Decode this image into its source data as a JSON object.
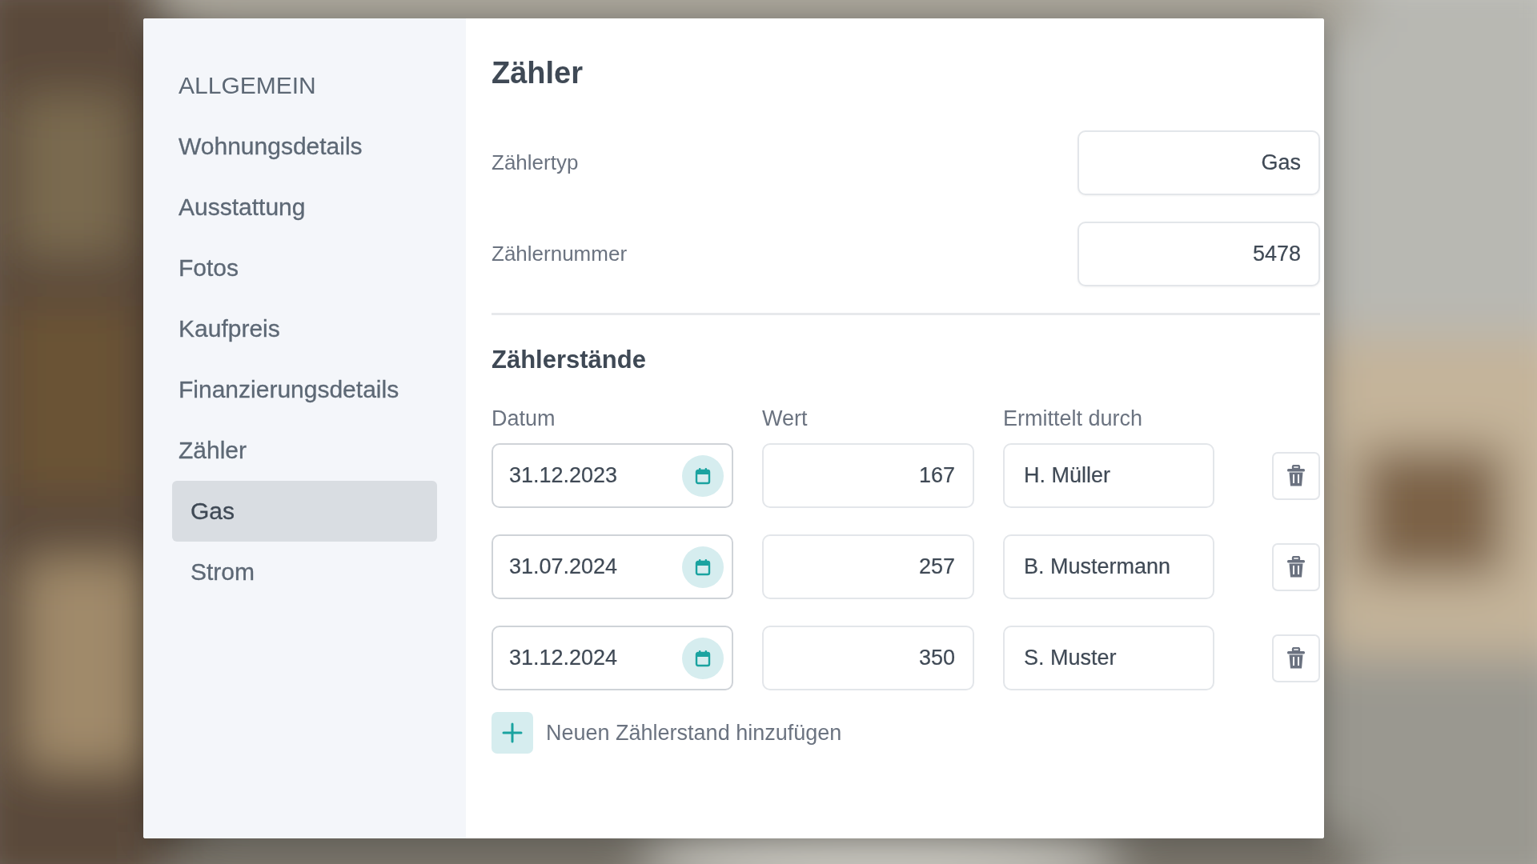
{
  "sidebar": {
    "heading": "ALLGEMEIN",
    "items": [
      {
        "label": "Wohnungsdetails",
        "selected": false
      },
      {
        "label": "Ausstattung",
        "selected": false
      },
      {
        "label": "Fotos",
        "selected": false
      },
      {
        "label": "Kaufpreis",
        "selected": false
      },
      {
        "label": "Finanzierungsdetails",
        "selected": false
      },
      {
        "label": "Zähler",
        "selected": false,
        "children": [
          {
            "label": "Gas",
            "selected": true
          },
          {
            "label": "Strom",
            "selected": false
          }
        ]
      }
    ]
  },
  "main": {
    "title": "Zähler",
    "fields": [
      {
        "label": "Zählertyp",
        "value": "Gas"
      },
      {
        "label": "Zählernummer",
        "value": "5478"
      }
    ],
    "readings": {
      "title": "Zählerstände",
      "columns": [
        "Datum",
        "Wert",
        "Ermittelt durch"
      ],
      "rows": [
        {
          "date": "31.12.2023",
          "value": "167",
          "by": "H. Müller"
        },
        {
          "date": "31.07.2024",
          "value": "257",
          "by": "B. Mustermann"
        },
        {
          "date": "31.12.2024",
          "value": "350",
          "by": "S. Muster"
        }
      ],
      "add_label": "Neuen Zählerstand hinzufügen"
    }
  }
}
